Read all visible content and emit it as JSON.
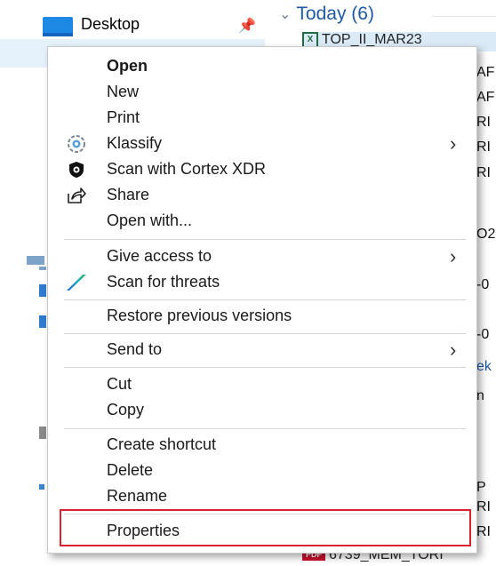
{
  "nav": {
    "items": [
      {
        "label": "Desktop"
      }
    ]
  },
  "content": {
    "group_title": "Today (6)",
    "top_file": "TOP_II_MAR23",
    "bottom_file": "6739_MEM_TORI",
    "edge_fragments": [
      "AF",
      "AF",
      "RI",
      "RI",
      "RI",
      "O2",
      "-0",
      "-0",
      "ek",
      "n",
      "P",
      "RI",
      "RI"
    ]
  },
  "menu": {
    "items": [
      {
        "label": "Open",
        "bold": true
      },
      {
        "label": "New"
      },
      {
        "label": "Print"
      },
      {
        "label": "Klassify",
        "icon": "klassify-icon",
        "submenu": true
      },
      {
        "label": "Scan with Cortex XDR",
        "icon": "cortex-shield-icon"
      },
      {
        "label": "Share",
        "icon": "share-icon"
      },
      {
        "label": "Open with..."
      },
      {
        "label": "Give access to",
        "submenu": true
      },
      {
        "label": "Scan for threats",
        "icon": "scan-threats-icon"
      },
      {
        "label": "Restore previous versions"
      },
      {
        "label": "Send to",
        "submenu": true
      },
      {
        "label": "Cut"
      },
      {
        "label": "Copy"
      },
      {
        "label": "Create shortcut"
      },
      {
        "label": "Delete"
      },
      {
        "label": "Rename"
      },
      {
        "label": "Properties",
        "highlighted": true
      }
    ],
    "highlight_color": "#d9232d"
  }
}
